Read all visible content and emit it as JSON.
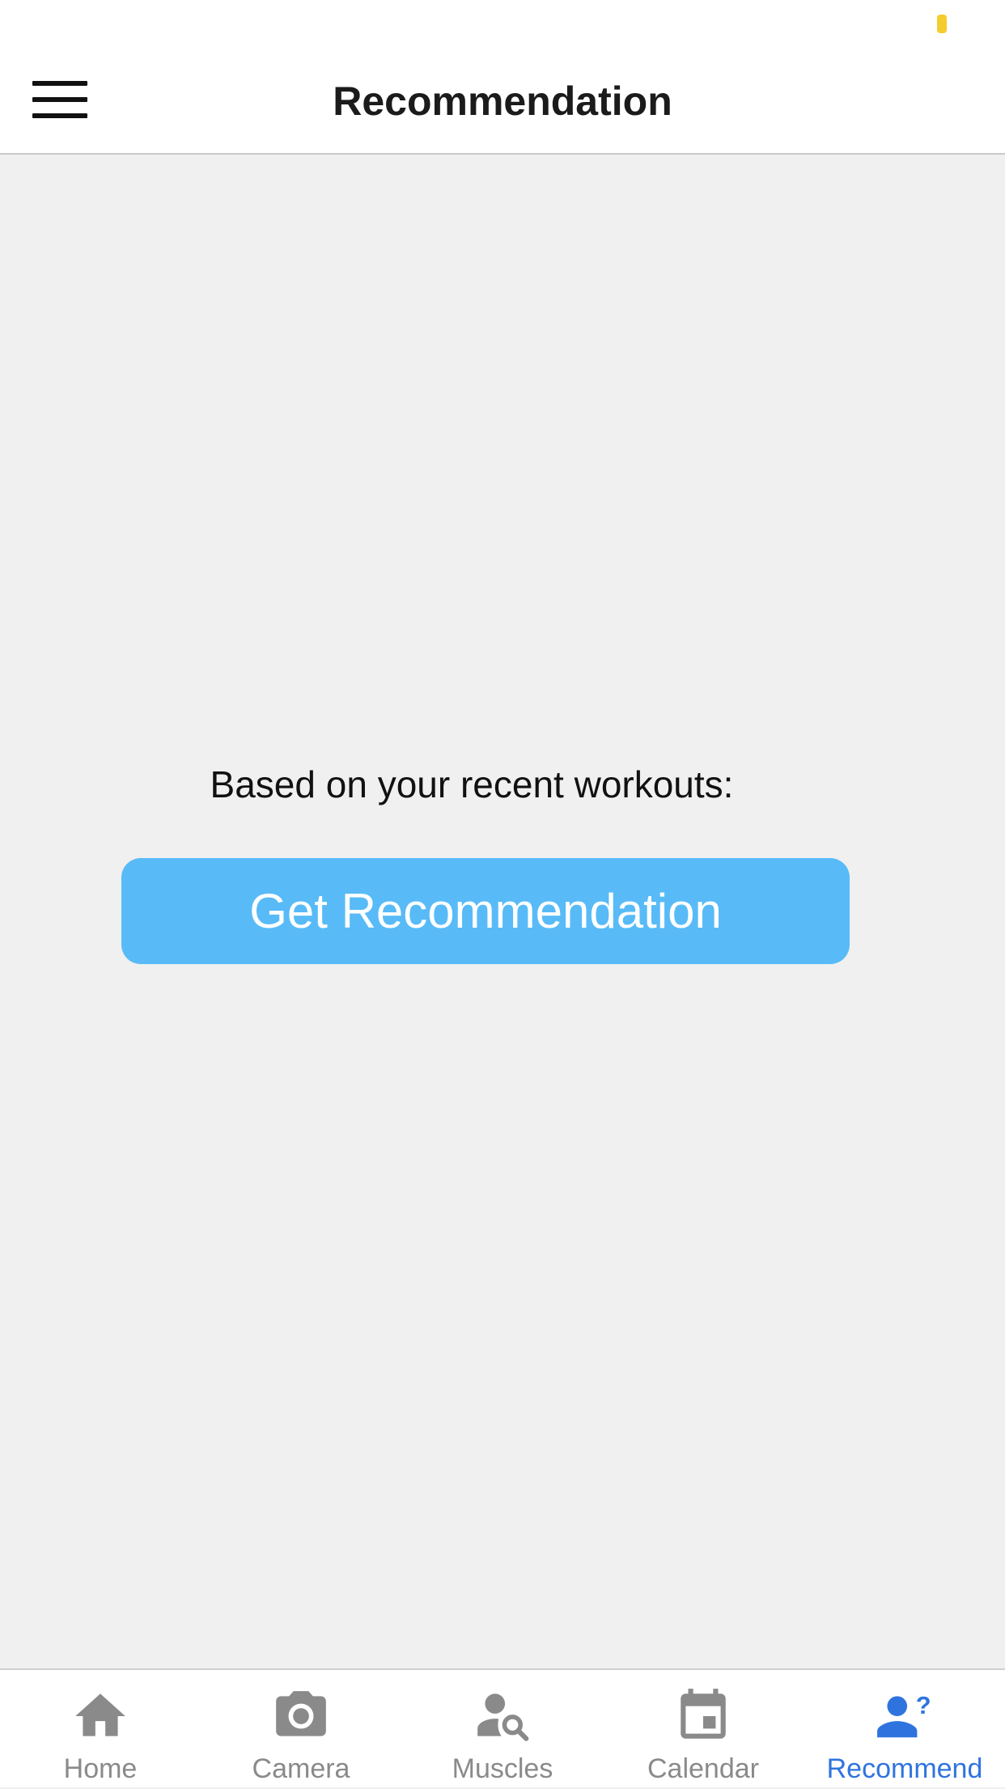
{
  "header": {
    "title": "Recommendation",
    "menu_icon": "hamburger-menu-icon"
  },
  "main": {
    "prompt": "Based on your recent workouts:",
    "button_label": "Get Recommendation"
  },
  "tabs": [
    {
      "label": "Home",
      "icon": "home-icon",
      "active": false
    },
    {
      "label": "Camera",
      "icon": "camera-icon",
      "active": false
    },
    {
      "label": "Muscles",
      "icon": "person-search-icon",
      "active": false
    },
    {
      "label": "Calendar",
      "icon": "calendar-icon",
      "active": false
    },
    {
      "label": "Recommend",
      "icon": "person-question-icon",
      "active": true
    }
  ],
  "colors": {
    "accent": "#2f74de",
    "button": "#58bbf7",
    "inactive": "#8a8a8a",
    "background": "#f0f0f0",
    "battery": "#f5cc2e"
  }
}
